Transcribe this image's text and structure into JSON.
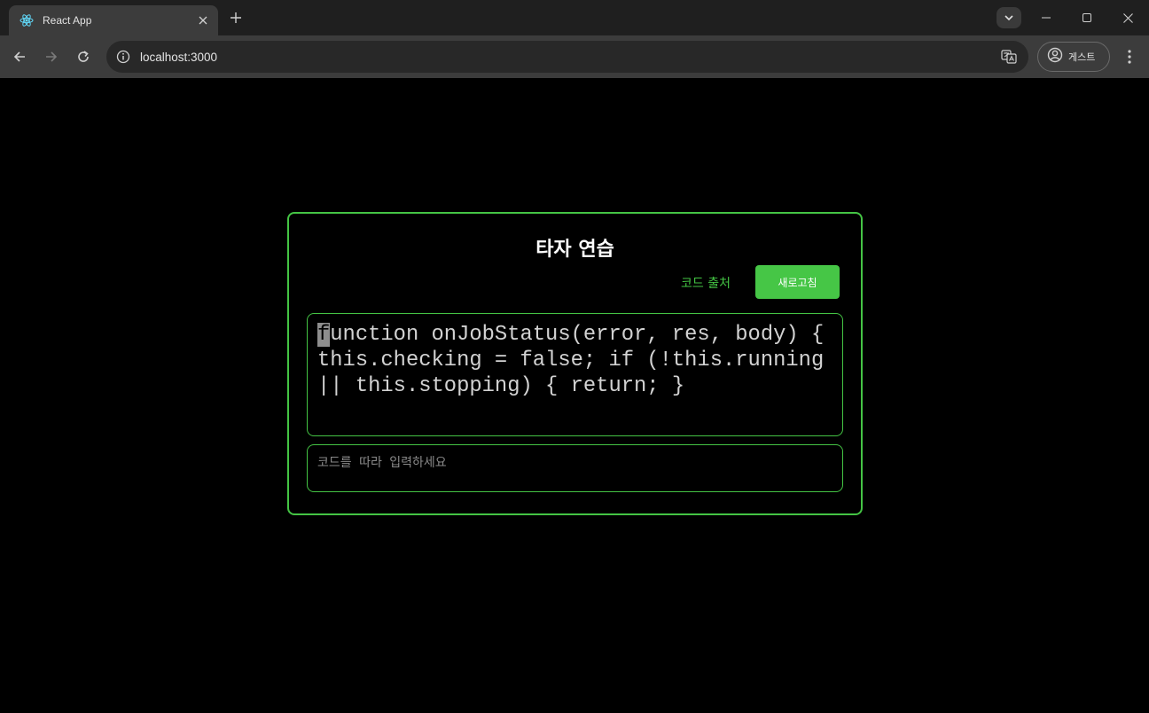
{
  "browser": {
    "tab_title": "React App",
    "url": "localhost:3000",
    "profile_label": "게스트"
  },
  "page": {
    "title": "타자 연습",
    "source_link": "코드 출처",
    "refresh_button": "새로고침",
    "code_first_char": "f",
    "code_rest": "unction onJobStatus(error, res, body) { this.checking = false; if (!this.running || this.stopping) { return; }",
    "input_placeholder": "코드를 따라 입력하세요"
  },
  "colors": {
    "accent": "#44c444",
    "button_bg": "#46c646",
    "page_bg": "#000000"
  },
  "icons": [
    "react-favicon",
    "close-icon",
    "plus-icon",
    "chevron-down-icon",
    "minimize-icon",
    "maximize-icon",
    "close-window-icon",
    "back-arrow-icon",
    "forward-arrow-icon",
    "reload-icon",
    "info-icon",
    "translate-icon",
    "profile-icon",
    "more-vert-icon"
  ]
}
